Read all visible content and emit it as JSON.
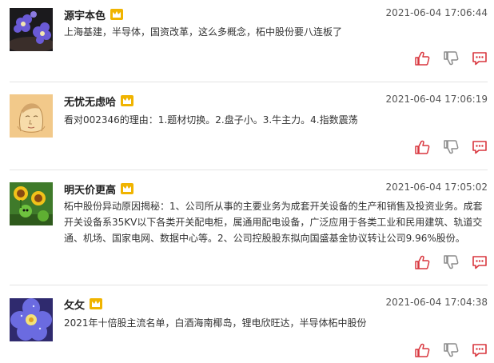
{
  "posts": [
    {
      "username": "源宇本色",
      "time": "2021-06-04 17:06:44",
      "content": "上海基建，半导体，国资改革，这么多概念，柘中股份要八连板了",
      "avatar_icon": "purple-flowers-avatar",
      "badge_icon": "crown-icon"
    },
    {
      "username": "无忧无虑哈",
      "time": "2021-06-04 17:06:19",
      "content": "看对002346的理由：1.题材切换。2.盘子小。3.牛主力。4.指数震荡",
      "avatar_icon": "sketch-face-avatar",
      "badge_icon": "crown-icon"
    },
    {
      "username": "明天价更高",
      "time": "2021-06-04 17:05:02",
      "content": "柘中股份异动原因揭秘：1、公司所从事的主要业务为成套开关设备的生产和销售及投资业务。成套开关设备系35KV以下各类开关配电柜，属通用配电设备，广泛应用于各类工业和民用建筑、轨道交通、机场、国家电网、数据中心等。2、公司控股股东拟向国盛基金协议转让公司9.96%股份。",
      "avatar_icon": "sunflower-game-avatar",
      "badge_icon": "crown-icon"
    },
    {
      "username": "攵攵",
      "time": "2021-06-04 17:04:38",
      "content": "2021年十倍股主流名单，白酒海南椰岛，锂电欣旺达，半导体柘中股份",
      "avatar_icon": "violet-flower-avatar",
      "badge_icon": "crown-icon"
    }
  ],
  "actions": {
    "like_icon": "thumbs-up-icon",
    "dislike_icon": "thumbs-down-icon",
    "comment_icon": "comment-icon"
  },
  "colors": {
    "action_red": "#d9363e",
    "action_gray": "#8c8c8c",
    "crown_gold": "#f0b400",
    "divider": "#e4e4e4"
  }
}
